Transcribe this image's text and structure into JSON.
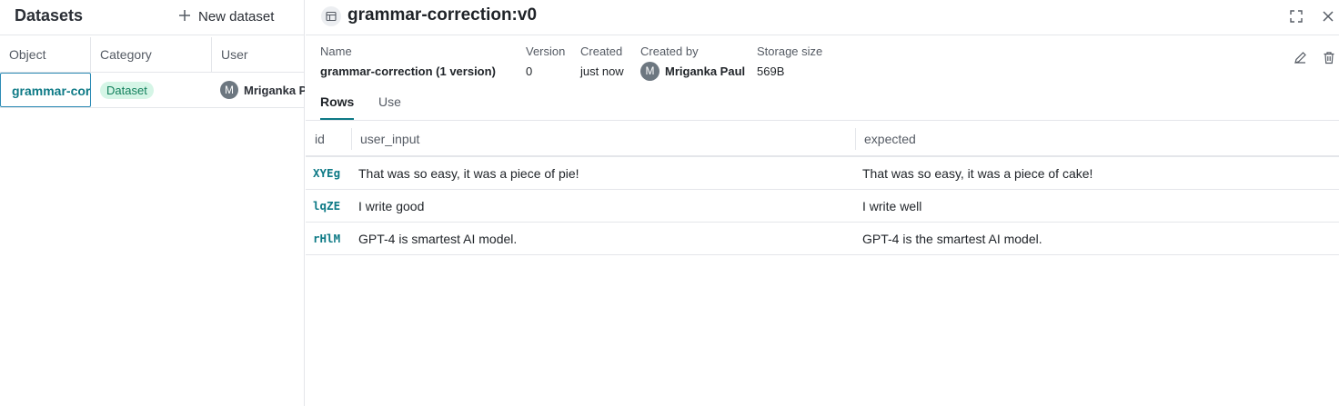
{
  "sidebar": {
    "title": "Datasets",
    "new_dataset_label": "New dataset",
    "columns": [
      "Object",
      "Category",
      "User"
    ],
    "rows": [
      {
        "object": "grammar-correction",
        "category": "Dataset",
        "user_initial": "M",
        "user": "Mriganka Paul"
      }
    ]
  },
  "detail": {
    "title": "grammar-correction:v0",
    "meta": {
      "name_label": "Name",
      "name_value": "grammar-correction (1 version)",
      "version_label": "Version",
      "version_value": "0",
      "created_label": "Created",
      "created_value": "just now",
      "created_by_label": "Created by",
      "created_by_initial": "M",
      "created_by_value": "Mriganka Paul",
      "storage_label": "Storage size",
      "storage_value": "569B"
    },
    "tabs": [
      "Rows",
      "Use"
    ],
    "active_tab": "Rows",
    "table": {
      "columns": [
        "id",
        "user_input",
        "expected"
      ],
      "rows": [
        {
          "id": "XYEg",
          "user_input": "That was so easy, it was a piece of pie!",
          "expected": "That was so easy, it was a piece of cake!"
        },
        {
          "id": "lqZE",
          "user_input": "I write good",
          "expected": "I write well"
        },
        {
          "id": "rHlM",
          "user_input": "GPT-4 is smartest AI model.",
          "expected": "GPT-4 is the smartest AI model."
        }
      ]
    }
  },
  "icons": {
    "new_dataset": "plus-icon",
    "object_type": "table-icon",
    "fullscreen": "fullscreen-icon",
    "close": "close-icon",
    "edit": "pencil-icon",
    "delete": "trash-icon"
  },
  "colors": {
    "accent": "#0e7a86",
    "badge_bg": "#d5f5e6",
    "badge_text": "#12805c",
    "avatar_bg": "#6d7780"
  }
}
